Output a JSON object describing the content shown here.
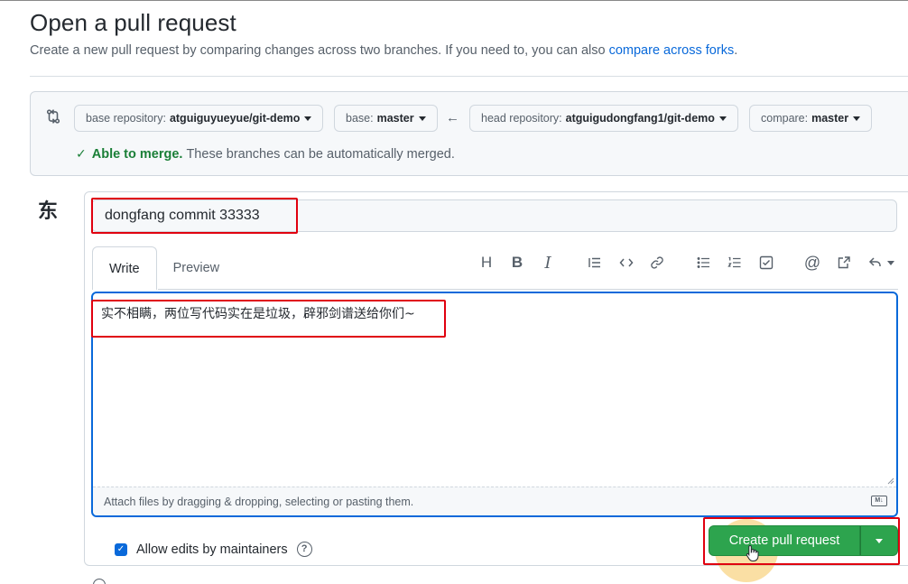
{
  "page": {
    "title": "Open a pull request",
    "subtitle": "Create a new pull request by comparing changes across two branches. If you need to, you can also",
    "subtitle_link": "compare across forks",
    "subtitle_end": "."
  },
  "compare": {
    "base_repo_label": "base repository:",
    "base_repo_value": "atguiguyueyue/git-demo",
    "base_label": "base:",
    "base_value": "master",
    "arrow": "←",
    "head_repo_label": "head repository:",
    "head_repo_value": "atguigudongfang1/git-demo",
    "compare_label": "compare:",
    "compare_value": "master",
    "merge_check": "✓",
    "merge_title": "Able to merge.",
    "merge_text": "These branches can be automatically merged."
  },
  "author": {
    "avatar_text": "东"
  },
  "form": {
    "title_value": "dongfang commit 33333",
    "tabs": [
      {
        "label": "Write",
        "active": true
      },
      {
        "label": "Preview",
        "active": false
      }
    ],
    "toolbar_icons": [
      "heading-icon",
      "bold-icon",
      "italic-icon",
      "quote-icon",
      "code-icon",
      "link-icon",
      "unordered-list-icon",
      "ordered-list-icon",
      "task-list-icon",
      "mention-icon",
      "cross-reference-icon",
      "reply-icon"
    ],
    "toolbar_text": {
      "heading": "H",
      "bold": "B",
      "italic": "I",
      "mention": "@"
    },
    "body_value": "实不相瞒，两位写代码实在是垃圾，辟邪剑谱送给你们~",
    "attach_text": "Attach files by dragging & dropping, selecting or pasting them.",
    "markdown_badge": "M↓"
  },
  "footer": {
    "allow_edits_label": "Allow edits by maintainers",
    "allow_edits_checked": true,
    "help": "?",
    "create_button": "Create pull request"
  },
  "colors": {
    "accent_blue": "#0969da",
    "success_green": "#2da44e",
    "merge_green": "#1a7f37",
    "annotation_red": "#e0000f"
  }
}
